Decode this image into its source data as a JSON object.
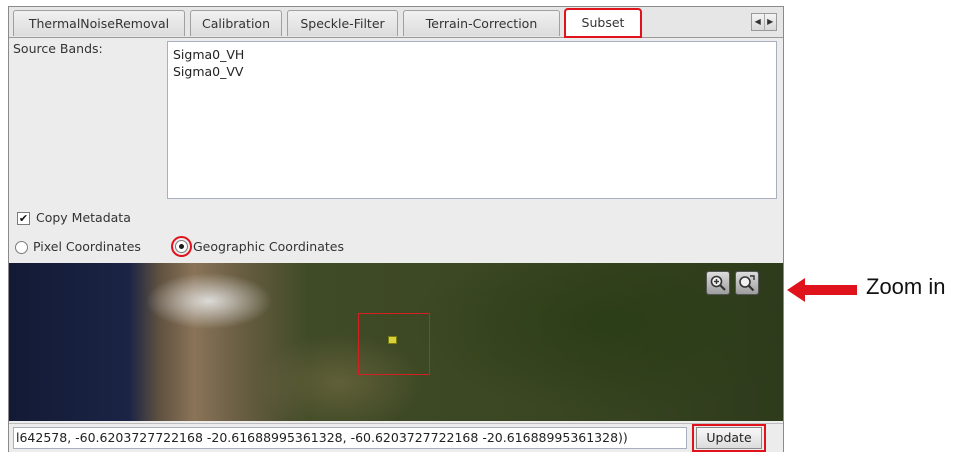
{
  "tabs": [
    {
      "label": "ThermalNoiseRemoval"
    },
    {
      "label": "Calibration"
    },
    {
      "label": "Speckle-Filter"
    },
    {
      "label": "Terrain-Correction"
    },
    {
      "label": "Subset",
      "active": true
    }
  ],
  "source_bands": {
    "label": "Source Bands:",
    "items": [
      "Sigma0_VH",
      "Sigma0_VV"
    ]
  },
  "copy_metadata": {
    "label": "Copy Metadata",
    "checked": true
  },
  "coordinates": {
    "pixel_label": "Pixel Coordinates",
    "geo_label": "Geographic Coordinates",
    "selected": "geographic"
  },
  "map": {
    "zoom_in_icon": "zoom-in-icon",
    "zoom_all_icon": "zoom-all-icon"
  },
  "geo_region": {
    "value": "l642578, -60.6203727722168 -20.61688995361328, -60.6203727722168 -20.61688995361328))"
  },
  "update_button": {
    "label": "Update"
  },
  "annotation": {
    "label": "Zoom in",
    "color": "#e0121b"
  },
  "colors": {
    "highlight": "#e0121b"
  }
}
